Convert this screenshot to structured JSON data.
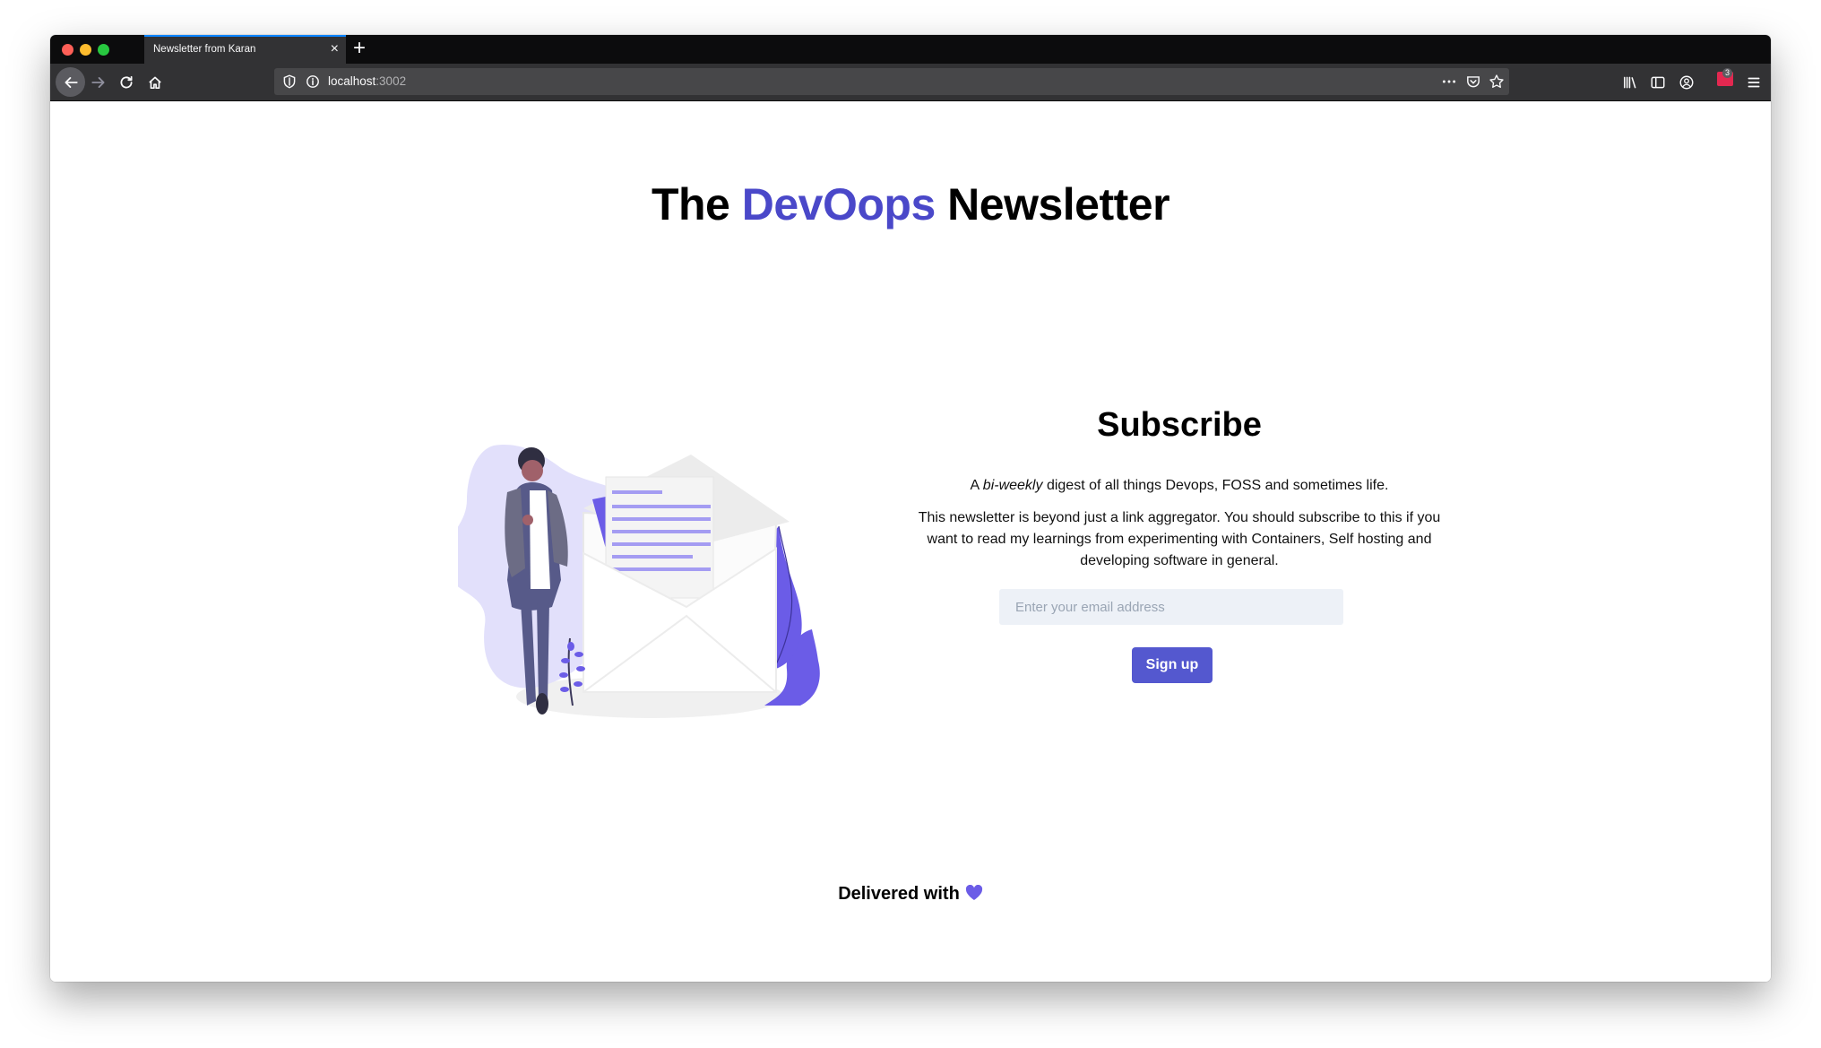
{
  "browser": {
    "tab_title": "Newsletter from Karan",
    "tab_close": "×",
    "new_tab": "+",
    "url_host": "localhost",
    "url_port": ":3002",
    "extension_badge_count": "3",
    "accent_color": "#0a84ff"
  },
  "page": {
    "headline_before": "The",
    "headline_accent": "DevOops",
    "headline_after": "Newsletter",
    "accent_color": "#4a48c9",
    "subscribe": {
      "title": "Subscribe",
      "tagline_prefix": "A",
      "tagline_em": "bi-weekly",
      "tagline_suffix": "digest of all things Devops, FOSS and sometimes life.",
      "paragraph": "This newsletter is beyond just a link aggregator. You should subscribe to this if you want to read my learnings from experimenting with Containers, Self hosting and developing software in general.",
      "email_placeholder": "Enter your email address",
      "email_value": "",
      "button_label": "Sign up",
      "button_color": "#5458cf"
    },
    "footer": {
      "text": "Delivered with",
      "icon": "heart-icon",
      "heart_color": "#6b5ce7"
    }
  }
}
